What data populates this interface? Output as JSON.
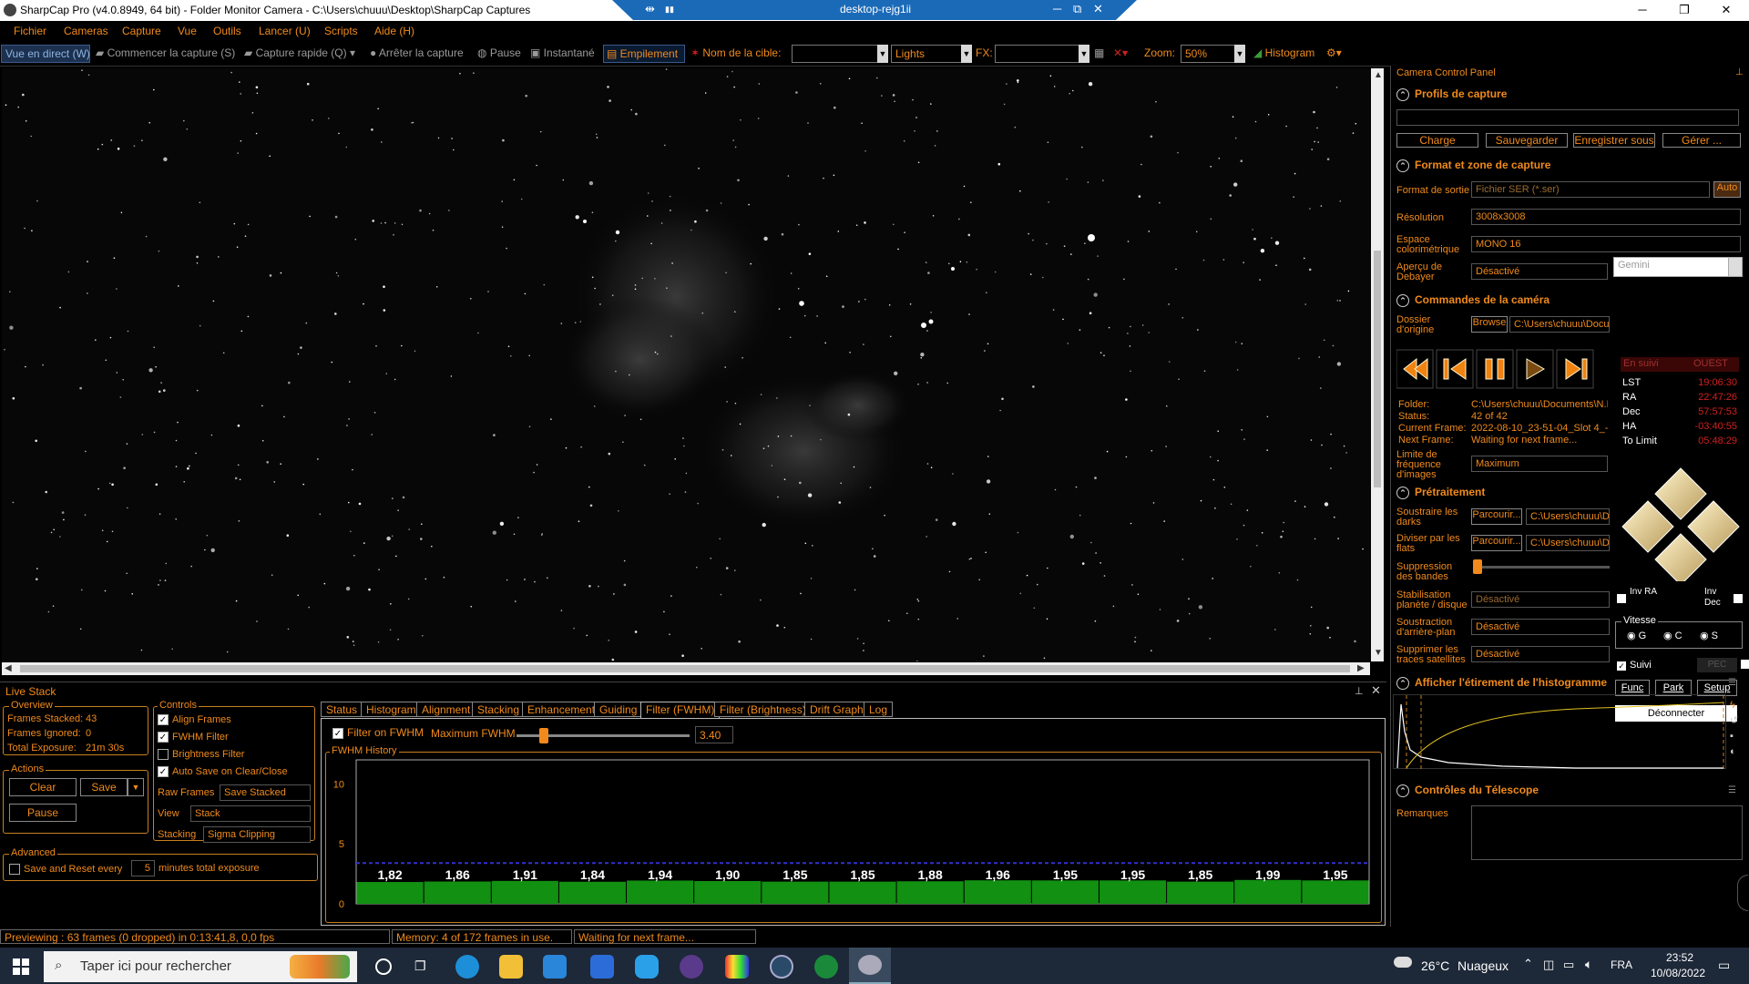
{
  "titlebar": {
    "title": "SharpCap Pro (v4.0.8949, 64 bit) - Folder Monitor Camera - C:\\Users\\chuuu\\Desktop\\SharpCap Captures",
    "minimize": "─",
    "maximize": "❐",
    "close": "✕"
  },
  "remote_bar": {
    "name": "desktop-rejg1ii",
    "pin": "⇹",
    "signal": "▮▮",
    "min": "─",
    "restore": "⧉",
    "close": "✕"
  },
  "menu": [
    "Fichier",
    "Cameras",
    "Capture",
    "Vue",
    "Outils",
    "Lancer (U)",
    "Scripts",
    "Aide (H)"
  ],
  "toolbar": {
    "live_view": "Vue en direct (W)",
    "start_capture": "Commencer la capture (S)",
    "quick_capture": "Capture rapide (Q)",
    "stop_capture": "Arrêter la capture",
    "pause": "Pause",
    "snapshot": "Instantané",
    "stacking": "Empilement",
    "target_label": "Nom de la cible:",
    "target_value": "",
    "frame_type": "Lights",
    "fx_label": "FX:",
    "fx_value": "",
    "zoom_label": "Zoom:",
    "zoom_value": "50%",
    "histogram": "Histogram"
  },
  "camera_panel": {
    "title": "Camera Control Panel",
    "profiles": {
      "header": "Profils de capture",
      "value": "",
      "load": "Charge",
      "save": "Sauvegarder",
      "save_as": "Enregistrer sous",
      "manage": "Gérer ..."
    },
    "format": {
      "header": "Format et zone de capture",
      "output_label": "Format de sortie",
      "output_value": "Fichier SER (*.ser)",
      "auto": "Auto",
      "resolution_label": "Résolution",
      "resolution_value": "3008x3008",
      "colorspace_label": "Espace colorimétrique",
      "colorspace_value": "MONO 16",
      "debayer_label": "Aperçu de Debayer",
      "debayer_value": "Désactivé"
    },
    "camera_controls": {
      "header": "Commandes de la caméra",
      "folder_label": "Dossier d'origine",
      "browse": "Browse",
      "folder_value": "C:\\Users\\chuuu\\Docu",
      "info_folder_label": "Folder:",
      "info_folder_value": "C:\\Users\\chuuu\\Documents\\N.I",
      "status_label": "Status:",
      "status_value": "42 of 42",
      "current_label": "Current Frame:",
      "current_value": "2022-08-10_23-51-04_Slot 4_-",
      "next_label": "Next Frame:",
      "next_value": "Waiting for next frame...",
      "rate_label": "Limite de fréquence d'images",
      "rate_value": "Maximum"
    },
    "preprocessing": {
      "header": "Prétraitement",
      "darks_label": "Soustraire les darks",
      "darks_btn": "Parcourir...",
      "darks_value": "C:\\Users\\chuuu\\D",
      "flats_label": "Diviser par les flats",
      "flats_btn": "Parcourir...",
      "flats_value": "C:\\Users\\chuuu\\D",
      "banding_label": "Suppression des bandes",
      "stab_label": "Stabilisation planète / disque",
      "stab_value": "Désactivé",
      "bg_label": "Soustraction d'arrière-plan",
      "bg_value": "Désactivé",
      "sat_label": "Supprimer les traces satellites",
      "sat_value": "Désactivé"
    },
    "histogram": {
      "header": "Afficher l'étirement de l'histogramme"
    },
    "telescope": {
      "header": "Contrôles du Télescope",
      "remarks": "Remarques"
    }
  },
  "mount": {
    "name": "Gemini",
    "tracking": "En suivi",
    "side": "OUEST",
    "rows": [
      {
        "label": "LST",
        "value": "19:06:30"
      },
      {
        "label": "RA",
        "value": "22:47:26"
      },
      {
        "label": "Dec",
        "value": "57:57:53"
      },
      {
        "label": "HA",
        "value": "-03:40:55"
      },
      {
        "label": "To Limit",
        "value": "05:48:29"
      }
    ],
    "inv_ra": "Inv RA",
    "inv_dec": "Inv Dec",
    "speed_label": "Vitesse",
    "speeds": [
      "G",
      "C",
      "S"
    ],
    "suivi": "Suivi",
    "pec": "PEC",
    "func": "Func",
    "park": "Park",
    "setup": "Setup",
    "disconnect": "Déconnecter"
  },
  "livestack": {
    "title": "Live Stack",
    "overview_title": "Overview",
    "overview": [
      {
        "label": "Frames Stacked:",
        "value": "43"
      },
      {
        "label": "Frames Ignored:",
        "value": "0"
      },
      {
        "label": "Total Exposure:",
        "value": "21m 30s"
      }
    ],
    "actions_title": "Actions",
    "clear": "Clear",
    "save": "Save",
    "pause": "Pause",
    "advanced_title": "Advanced",
    "save_reset_label": "Save and Reset every",
    "save_reset_value": "5",
    "save_reset_suffix": "minutes total exposure",
    "controls_title": "Controls",
    "controls": [
      {
        "label": "Align Frames",
        "checked": true
      },
      {
        "label": "FWHM Filter",
        "checked": true
      },
      {
        "label": "Brightness Filter",
        "checked": false
      },
      {
        "label": "Auto Save on Clear/Close",
        "checked": true
      }
    ],
    "raw_label": "Raw Frames",
    "raw_value": "Save Stacked",
    "view_label": "View",
    "view_value": "Stack",
    "stacking_label": "Stacking",
    "stacking_value": "Sigma Clipping",
    "tabs": [
      "Status",
      "Histogram",
      "Alignment",
      "Stacking",
      "Enhancement",
      "Guiding",
      "Filter (FWHM)",
      "Filter (Brightness)",
      "Drift Graph",
      "Log"
    ],
    "active_tab": "Filter (FWHM)",
    "filter_label": "Filter on FWHM",
    "max_label": "Maximum FWHM",
    "max_value": "3.40",
    "max_fraction": 0.16,
    "history_title": "FWHM History"
  },
  "chart_data": {
    "type": "bar",
    "title": "FWHM History",
    "ylim": [
      0,
      12
    ],
    "yticks": [
      "10",
      "5",
      "0"
    ],
    "threshold": 3.4,
    "values": [
      1.82,
      1.86,
      1.91,
      1.84,
      1.94,
      1.9,
      1.85,
      1.85,
      1.88,
      1.96,
      1.95,
      1.95,
      1.85,
      1.99,
      1.95
    ],
    "labels": [
      "1,82",
      "1,86",
      "1,91",
      "1,84",
      "1,94",
      "1,90",
      "1,85",
      "1,85",
      "1,88",
      "1,96",
      "1,95",
      "1,95",
      "1,85",
      "1,99",
      "1,95"
    ],
    "bar_color": "#119011",
    "threshold_color": "#3030d0"
  },
  "statusbar": {
    "preview": "Previewing : 63 frames (0 dropped) in 0:13:41,8, 0,0 fps",
    "memory": "Memory: 4 of 172 frames in use.",
    "waiting": "Waiting for next frame..."
  },
  "taskbar": {
    "search_placeholder": "Taper ici pour rechercher",
    "weather_temp": "26°C",
    "weather_text": "Nuageux",
    "lang": "FRA",
    "time": "23:52",
    "date": "10/08/2022"
  },
  "colors": {
    "accent": "#f08a1c",
    "panel_bg": "#000000",
    "mount_red": "#d02020",
    "win_taskbar": "#1d2838"
  }
}
